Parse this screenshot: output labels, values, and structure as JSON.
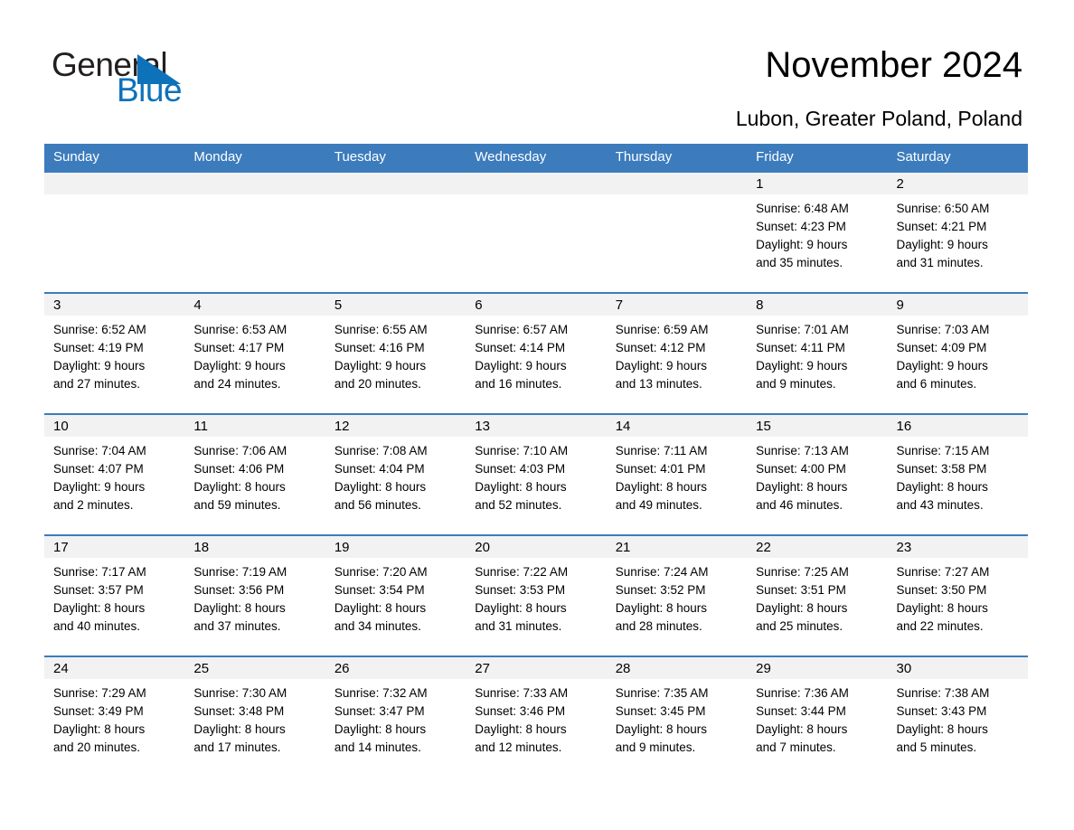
{
  "brand": {
    "name_part1": "General",
    "name_part2": "Blue",
    "triangle_color": "#0d72b9",
    "blue_text_color": "#0d72b9",
    "dark_text_color": "#231f20"
  },
  "header": {
    "title": "November 2024",
    "subtitle": "Lubon, Greater Poland, Poland"
  },
  "theme": {
    "header_bar_color": "#3c7cbd",
    "daynum_band_color": "#f2f2f2",
    "row_rule_color": "#3c7cbd",
    "page_background": "#ffffff"
  },
  "calendar": {
    "weekday_headers": [
      "Sunday",
      "Monday",
      "Tuesday",
      "Wednesday",
      "Thursday",
      "Friday",
      "Saturday"
    ],
    "weeks": [
      [
        {
          "day": "",
          "blank": true,
          "sunrise": "",
          "sunset": "",
          "daylight_line1": "",
          "daylight_line2": ""
        },
        {
          "day": "",
          "blank": true,
          "sunrise": "",
          "sunset": "",
          "daylight_line1": "",
          "daylight_line2": ""
        },
        {
          "day": "",
          "blank": true,
          "sunrise": "",
          "sunset": "",
          "daylight_line1": "",
          "daylight_line2": ""
        },
        {
          "day": "",
          "blank": true,
          "sunrise": "",
          "sunset": "",
          "daylight_line1": "",
          "daylight_line2": ""
        },
        {
          "day": "",
          "blank": true,
          "sunrise": "",
          "sunset": "",
          "daylight_line1": "",
          "daylight_line2": ""
        },
        {
          "day": "1",
          "blank": false,
          "sunrise": "Sunrise: 6:48 AM",
          "sunset": "Sunset: 4:23 PM",
          "daylight_line1": "Daylight: 9 hours",
          "daylight_line2": "and 35 minutes."
        },
        {
          "day": "2",
          "blank": false,
          "sunrise": "Sunrise: 6:50 AM",
          "sunset": "Sunset: 4:21 PM",
          "daylight_line1": "Daylight: 9 hours",
          "daylight_line2": "and 31 minutes."
        }
      ],
      [
        {
          "day": "3",
          "blank": false,
          "sunrise": "Sunrise: 6:52 AM",
          "sunset": "Sunset: 4:19 PM",
          "daylight_line1": "Daylight: 9 hours",
          "daylight_line2": "and 27 minutes."
        },
        {
          "day": "4",
          "blank": false,
          "sunrise": "Sunrise: 6:53 AM",
          "sunset": "Sunset: 4:17 PM",
          "daylight_line1": "Daylight: 9 hours",
          "daylight_line2": "and 24 minutes."
        },
        {
          "day": "5",
          "blank": false,
          "sunrise": "Sunrise: 6:55 AM",
          "sunset": "Sunset: 4:16 PM",
          "daylight_line1": "Daylight: 9 hours",
          "daylight_line2": "and 20 minutes."
        },
        {
          "day": "6",
          "blank": false,
          "sunrise": "Sunrise: 6:57 AM",
          "sunset": "Sunset: 4:14 PM",
          "daylight_line1": "Daylight: 9 hours",
          "daylight_line2": "and 16 minutes."
        },
        {
          "day": "7",
          "blank": false,
          "sunrise": "Sunrise: 6:59 AM",
          "sunset": "Sunset: 4:12 PM",
          "daylight_line1": "Daylight: 9 hours",
          "daylight_line2": "and 13 minutes."
        },
        {
          "day": "8",
          "blank": false,
          "sunrise": "Sunrise: 7:01 AM",
          "sunset": "Sunset: 4:11 PM",
          "daylight_line1": "Daylight: 9 hours",
          "daylight_line2": "and 9 minutes."
        },
        {
          "day": "9",
          "blank": false,
          "sunrise": "Sunrise: 7:03 AM",
          "sunset": "Sunset: 4:09 PM",
          "daylight_line1": "Daylight: 9 hours",
          "daylight_line2": "and 6 minutes."
        }
      ],
      [
        {
          "day": "10",
          "blank": false,
          "sunrise": "Sunrise: 7:04 AM",
          "sunset": "Sunset: 4:07 PM",
          "daylight_line1": "Daylight: 9 hours",
          "daylight_line2": "and 2 minutes."
        },
        {
          "day": "11",
          "blank": false,
          "sunrise": "Sunrise: 7:06 AM",
          "sunset": "Sunset: 4:06 PM",
          "daylight_line1": "Daylight: 8 hours",
          "daylight_line2": "and 59 minutes."
        },
        {
          "day": "12",
          "blank": false,
          "sunrise": "Sunrise: 7:08 AM",
          "sunset": "Sunset: 4:04 PM",
          "daylight_line1": "Daylight: 8 hours",
          "daylight_line2": "and 56 minutes."
        },
        {
          "day": "13",
          "blank": false,
          "sunrise": "Sunrise: 7:10 AM",
          "sunset": "Sunset: 4:03 PM",
          "daylight_line1": "Daylight: 8 hours",
          "daylight_line2": "and 52 minutes."
        },
        {
          "day": "14",
          "blank": false,
          "sunrise": "Sunrise: 7:11 AM",
          "sunset": "Sunset: 4:01 PM",
          "daylight_line1": "Daylight: 8 hours",
          "daylight_line2": "and 49 minutes."
        },
        {
          "day": "15",
          "blank": false,
          "sunrise": "Sunrise: 7:13 AM",
          "sunset": "Sunset: 4:00 PM",
          "daylight_line1": "Daylight: 8 hours",
          "daylight_line2": "and 46 minutes."
        },
        {
          "day": "16",
          "blank": false,
          "sunrise": "Sunrise: 7:15 AM",
          "sunset": "Sunset: 3:58 PM",
          "daylight_line1": "Daylight: 8 hours",
          "daylight_line2": "and 43 minutes."
        }
      ],
      [
        {
          "day": "17",
          "blank": false,
          "sunrise": "Sunrise: 7:17 AM",
          "sunset": "Sunset: 3:57 PM",
          "daylight_line1": "Daylight: 8 hours",
          "daylight_line2": "and 40 minutes."
        },
        {
          "day": "18",
          "blank": false,
          "sunrise": "Sunrise: 7:19 AM",
          "sunset": "Sunset: 3:56 PM",
          "daylight_line1": "Daylight: 8 hours",
          "daylight_line2": "and 37 minutes."
        },
        {
          "day": "19",
          "blank": false,
          "sunrise": "Sunrise: 7:20 AM",
          "sunset": "Sunset: 3:54 PM",
          "daylight_line1": "Daylight: 8 hours",
          "daylight_line2": "and 34 minutes."
        },
        {
          "day": "20",
          "blank": false,
          "sunrise": "Sunrise: 7:22 AM",
          "sunset": "Sunset: 3:53 PM",
          "daylight_line1": "Daylight: 8 hours",
          "daylight_line2": "and 31 minutes."
        },
        {
          "day": "21",
          "blank": false,
          "sunrise": "Sunrise: 7:24 AM",
          "sunset": "Sunset: 3:52 PM",
          "daylight_line1": "Daylight: 8 hours",
          "daylight_line2": "and 28 minutes."
        },
        {
          "day": "22",
          "blank": false,
          "sunrise": "Sunrise: 7:25 AM",
          "sunset": "Sunset: 3:51 PM",
          "daylight_line1": "Daylight: 8 hours",
          "daylight_line2": "and 25 minutes."
        },
        {
          "day": "23",
          "blank": false,
          "sunrise": "Sunrise: 7:27 AM",
          "sunset": "Sunset: 3:50 PM",
          "daylight_line1": "Daylight: 8 hours",
          "daylight_line2": "and 22 minutes."
        }
      ],
      [
        {
          "day": "24",
          "blank": false,
          "sunrise": "Sunrise: 7:29 AM",
          "sunset": "Sunset: 3:49 PM",
          "daylight_line1": "Daylight: 8 hours",
          "daylight_line2": "and 20 minutes."
        },
        {
          "day": "25",
          "blank": false,
          "sunrise": "Sunrise: 7:30 AM",
          "sunset": "Sunset: 3:48 PM",
          "daylight_line1": "Daylight: 8 hours",
          "daylight_line2": "and 17 minutes."
        },
        {
          "day": "26",
          "blank": false,
          "sunrise": "Sunrise: 7:32 AM",
          "sunset": "Sunset: 3:47 PM",
          "daylight_line1": "Daylight: 8 hours",
          "daylight_line2": "and 14 minutes."
        },
        {
          "day": "27",
          "blank": false,
          "sunrise": "Sunrise: 7:33 AM",
          "sunset": "Sunset: 3:46 PM",
          "daylight_line1": "Daylight: 8 hours",
          "daylight_line2": "and 12 minutes."
        },
        {
          "day": "28",
          "blank": false,
          "sunrise": "Sunrise: 7:35 AM",
          "sunset": "Sunset: 3:45 PM",
          "daylight_line1": "Daylight: 8 hours",
          "daylight_line2": "and 9 minutes."
        },
        {
          "day": "29",
          "blank": false,
          "sunrise": "Sunrise: 7:36 AM",
          "sunset": "Sunset: 3:44 PM",
          "daylight_line1": "Daylight: 8 hours",
          "daylight_line2": "and 7 minutes."
        },
        {
          "day": "30",
          "blank": false,
          "sunrise": "Sunrise: 7:38 AM",
          "sunset": "Sunset: 3:43 PM",
          "daylight_line1": "Daylight: 8 hours",
          "daylight_line2": "and 5 minutes."
        }
      ]
    ]
  }
}
